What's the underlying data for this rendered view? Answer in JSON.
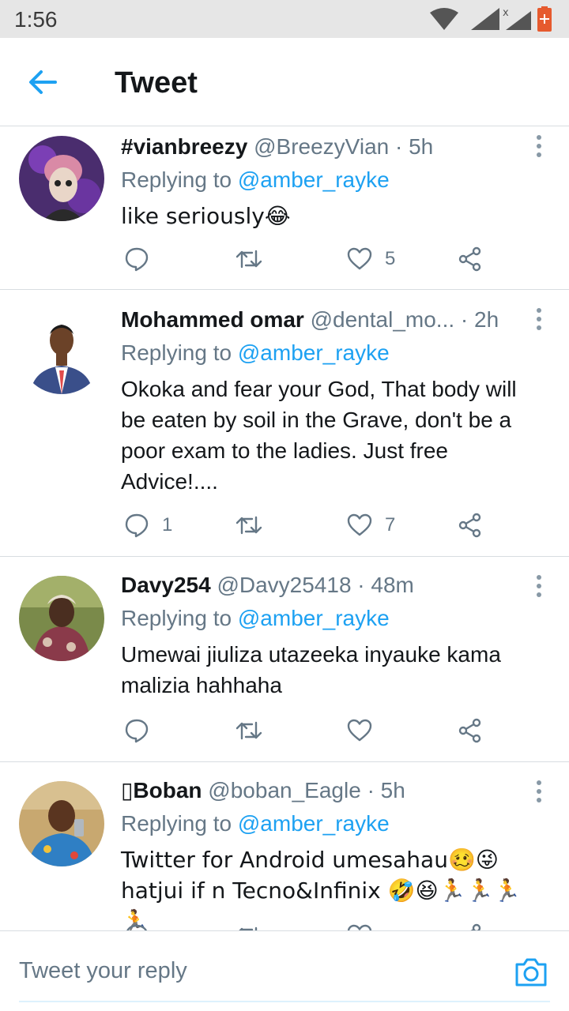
{
  "status_bar": {
    "time": "1:56"
  },
  "app_bar": {
    "title": "Tweet"
  },
  "tweets": [
    {
      "name": "#vianbreezy",
      "handle": "@BreezyVian",
      "time": "· 5h",
      "replying_prefix": "Replying to",
      "replying_to": "@amber_rayke",
      "text": "like seriously😂",
      "reply_count": "",
      "like_count": "5"
    },
    {
      "name": "Mohammed omar",
      "handle": "@dental_mo...",
      "time": "· 2h",
      "replying_prefix": "Replying to",
      "replying_to": "@amber_rayke",
      "text": "Okoka and fear your God, That body will be eaten by soil in the Grave, don't be a poor exam to the ladies. Just free Advice!....",
      "reply_count": "1",
      "like_count": "7"
    },
    {
      "name": "Davy254",
      "handle": "@Davy25418",
      "time": "· 48m",
      "replying_prefix": "Replying to",
      "replying_to": "@amber_rayke",
      "text": "Umewai jiuliza utazeeka inyauke kama malizia hahhaha",
      "reply_count": "",
      "like_count": ""
    },
    {
      "name": "▯Boban",
      "handle": "@boban_Eagle",
      "time": "· 5h",
      "replying_prefix": "Replying to",
      "replying_to": "@amber_rayke",
      "text": "Twitter for Android umesahau🥴😜 hatjui if n Tecno&Infinix 🤣😆🏃🏃🏃🏃",
      "reply_count": "",
      "like_count": ""
    }
  ],
  "reply_bar": {
    "placeholder": "Tweet your reply"
  },
  "icons": {
    "back": "arrow-left-icon",
    "more": "vertical-dots-icon",
    "reply": "speech-bubble-icon",
    "retweet": "retweet-icon",
    "like": "heart-icon",
    "share": "share-icon",
    "camera": "camera-icon"
  },
  "colors": {
    "accent": "#1da1f2",
    "secondary_text": "#657786",
    "primary_text": "#14171a"
  }
}
